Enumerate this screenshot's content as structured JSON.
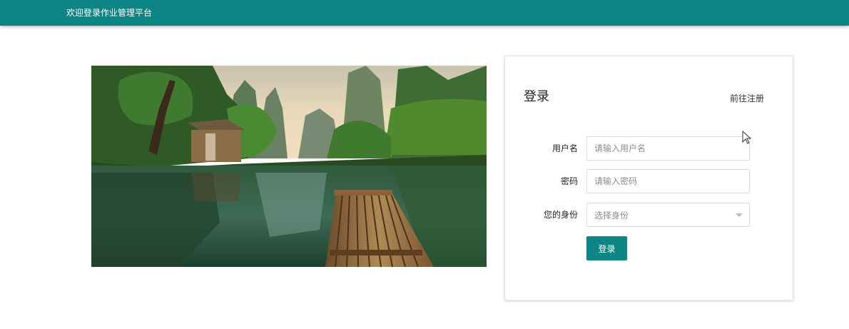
{
  "header": {
    "title": "欢迎登录作业管理平台"
  },
  "login": {
    "title": "登录",
    "register_link": "前往注册",
    "fields": {
      "username": {
        "label": "用户名",
        "placeholder": "请输入用户名",
        "value": ""
      },
      "password": {
        "label": "密码",
        "placeholder": "请输入密码",
        "value": ""
      },
      "identity": {
        "label": "您的身份",
        "placeholder": "选择身份",
        "selected": ""
      }
    },
    "submit_label": "登录"
  },
  "colors": {
    "brand": "#0e8585",
    "header_text": "#ffffff",
    "placeholder": "#8c8c8c"
  },
  "icons": {
    "dropdown": "chevron-down-icon",
    "cursor": "mouse-pointer-icon"
  }
}
